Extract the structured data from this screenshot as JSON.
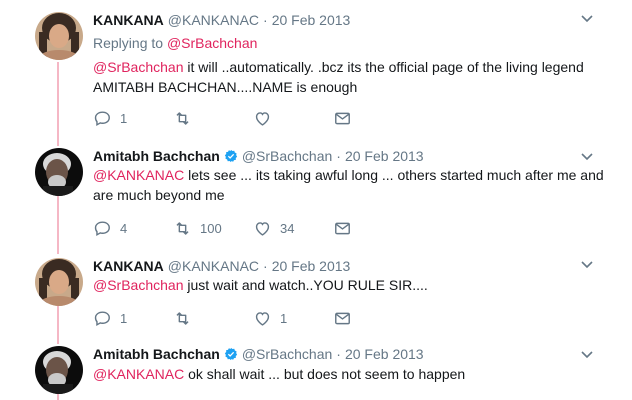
{
  "tweets": [
    {
      "name": "KANKANA",
      "verified": false,
      "handle": "@KANKANAC",
      "sep": "·",
      "date": "20 Feb 2013",
      "replying_label": "Replying to",
      "replying_to": "@SrBachchan",
      "mention": "@SrBachchan",
      "text_line1": " it will ..automatically. .bcz its the official page of the living legend",
      "text_line2": "AMITABH BACHCHAN....NAME is enough",
      "reply_count": "1",
      "retweet_count": "",
      "like_count": "",
      "avatar": "woman-avatar"
    },
    {
      "name": "Amitabh Bachchan",
      "verified": true,
      "handle": "@SrBachchan",
      "sep": "·",
      "date": "20 Feb 2013",
      "mention": "@KANKANAC",
      "text_line1": " lets see ... its taking awful long ... others started much after me and",
      "text_line2": "are much beyond me",
      "reply_count": "4",
      "retweet_count": "100",
      "like_count": "34",
      "avatar": "man-avatar"
    },
    {
      "name": "KANKANA",
      "verified": false,
      "handle": "@KANKANAC",
      "sep": "·",
      "date": "20 Feb 2013",
      "mention": "@SrBachchan",
      "text_line1": " just wait and watch..YOU RULE SIR....",
      "reply_count": "1",
      "retweet_count": "",
      "like_count": "1",
      "avatar": "woman-avatar"
    },
    {
      "name": "Amitabh Bachchan",
      "verified": true,
      "handle": "@SrBachchan",
      "sep": "·",
      "date": "20 Feb 2013",
      "mention": "@KANKANAC",
      "text_line1": " ok shall wait ... but does not seem to happen",
      "avatar": "man-avatar"
    }
  ],
  "colors": {
    "mention": "#e0245e",
    "thread_line": "#f5b7c5",
    "verified": "#1da1f2",
    "muted": "#657786"
  },
  "icons": [
    "reply-icon",
    "retweet-icon",
    "like-icon",
    "message-icon",
    "verified-icon",
    "chevron-down-icon"
  ]
}
